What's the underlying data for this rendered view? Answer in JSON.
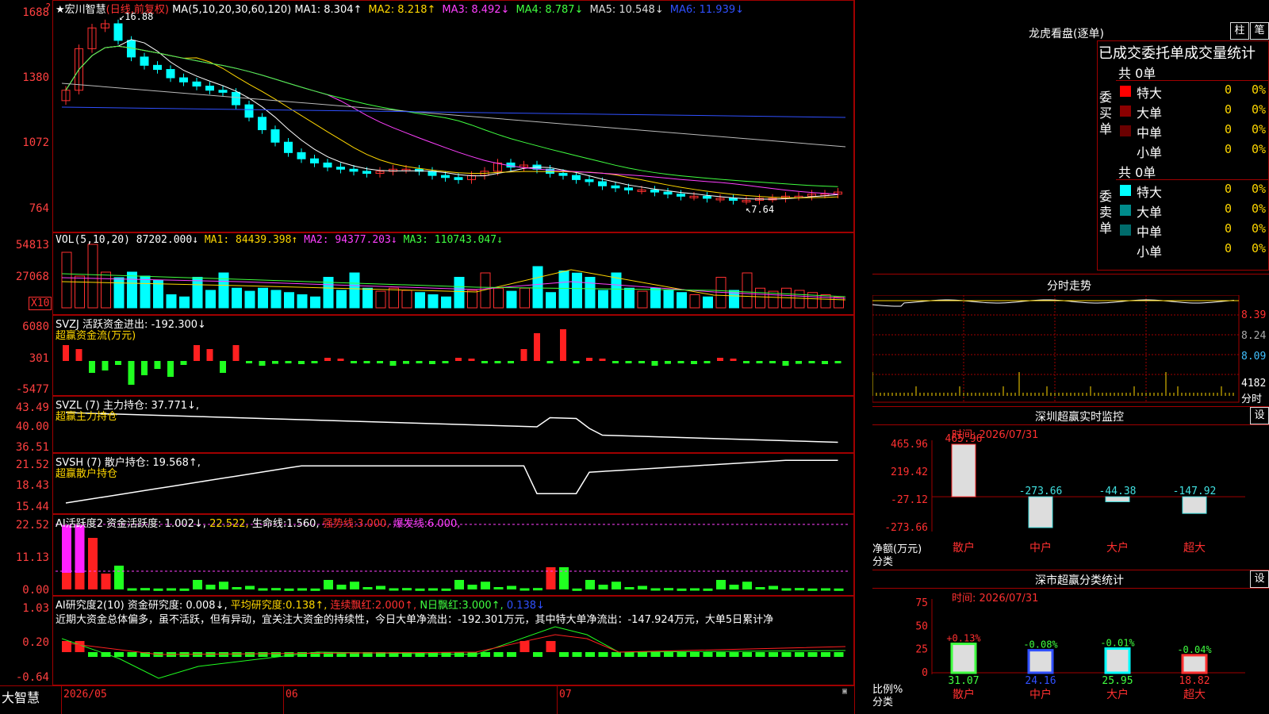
{
  "stock": {
    "title": "★宏川智慧",
    "period": "(日线,前复权)"
  },
  "ma_legend": {
    "label": "MA(5,10,20,30,60,120)",
    "items": [
      {
        "name": "MA1:",
        "value": "8.304↑",
        "color": "#ffffff"
      },
      {
        "name": "MA2:",
        "value": "8.218↑",
        "color": "#ffd700"
      },
      {
        "name": "MA3:",
        "value": "8.492↓",
        "color": "#ff40ff"
      },
      {
        "name": "MA4:",
        "value": "8.787↓",
        "color": "#40ff40"
      },
      {
        "name": "MA5:",
        "value": "10.548↓",
        "color": "#dddddd"
      },
      {
        "name": "MA6:",
        "value": "11.939↓",
        "color": "#3050ff"
      }
    ]
  },
  "price_axis": [
    "1688",
    "1380",
    "1072",
    "764"
  ],
  "price_marks": {
    "high": "16.88",
    "low": "7.64"
  },
  "vol_legend": {
    "label": "VOL(5,10,20)",
    "value": "87202.000↓",
    "items": [
      {
        "name": "MA1:",
        "value": "84439.398↑",
        "color": "#ffd700"
      },
      {
        "name": "MA2:",
        "value": "94377.203↓",
        "color": "#ff40ff"
      },
      {
        "name": "MA3:",
        "value": "110743.047↓",
        "color": "#40ff40"
      }
    ]
  },
  "vol_axis": [
    "54813",
    "27068"
  ],
  "vol_unit": "X10",
  "svzj": {
    "label": "SVZJ",
    "text": "活跃资金进出:",
    "value": "-192.300↓",
    "sub": "超赢资金流(万元)",
    "axis": [
      "6080",
      "301",
      "-5477"
    ]
  },
  "svzl": {
    "label": "SVZL (7)",
    "text": "主力持仓:",
    "value": "37.771↓,",
    "sub": "超赢主力持仓",
    "axis": [
      "43.49",
      "40.00",
      "36.51"
    ]
  },
  "svsh": {
    "label": "SVSH (7)",
    "text": "散户持仓:",
    "value": "19.568↑,",
    "sub": "超赢散户持仓",
    "axis": [
      "21.52",
      "18.43",
      "15.44"
    ]
  },
  "ai1": {
    "label": "AI活跃度2",
    "text": "资金活跃度:",
    "v1": "1.002↓,",
    "v2": "22.522,",
    "t3": "生命线:",
    "v3": "1.560,",
    "t4": "强势线:",
    "v4": "3.000,",
    "t5": "爆发线:",
    "v5": "6.000,",
    "axis": [
      "22.52",
      "11.13",
      "0.00"
    ]
  },
  "ai2": {
    "label": "AI研究度2(10)",
    "text": "资金研究度:",
    "v1": "0.008↓,",
    "t2": "平均研究度:",
    "v2": "0.138↑,",
    "t3": "连续飘红:",
    "v3": "2.000↑,",
    "t4": "N日飘红:",
    "v4": "3.000↑,",
    "v5": "0.138↓",
    "comment": "近期大资金总体偏多，虽不活跃，但有异动，宜关注大资金的持续性，今日大单净流出：-192.301万元，其中特大单净流出：-147.924万元，大单5日累计净",
    "axis": [
      "1.03",
      "0.20",
      "-0.64"
    ]
  },
  "date_axis": [
    "2026/05",
    "06",
    "07"
  ],
  "brand": "大智慧",
  "right": {
    "lhb_title": "龙虎看盘(逐单)",
    "btn_zhu": "柱",
    "btn_bi": "笔",
    "stats_header": "已成交委托单成交量统计",
    "buy": {
      "side": "委买单",
      "total": "共 0单",
      "rows": [
        {
          "label": "特大",
          "count": "0",
          "pct": "0%",
          "color": "#ff0000"
        },
        {
          "label": "大单",
          "count": "0",
          "pct": "0%",
          "color": "#8b0000"
        },
        {
          "label": "中单",
          "count": "0",
          "pct": "0%",
          "color": "#6a0000"
        },
        {
          "label": "小单",
          "count": "0",
          "pct": "0%",
          "color": "#000000"
        }
      ]
    },
    "sell": {
      "side": "委卖单",
      "total": "共 0单",
      "rows": [
        {
          "label": "特大",
          "count": "0",
          "pct": "0%",
          "color": "#00ffff"
        },
        {
          "label": "大单",
          "count": "0",
          "pct": "0%",
          "color": "#008b8b"
        },
        {
          "label": "中单",
          "count": "0",
          "pct": "0%",
          "color": "#006b6b"
        },
        {
          "label": "小单",
          "count": "0",
          "pct": "0%",
          "color": "#000000"
        }
      ]
    },
    "fenshi_title": "分时走势",
    "fenshi_axis": [
      "8.39",
      "8.24",
      "8.09"
    ],
    "fenshi_vol": "4182",
    "fenshi_unit": "分时",
    "monitor_title": "深圳超赢实时监控",
    "btn_set": "设",
    "monitor_time": "时间: 2026/07/31",
    "monitor_axis": [
      "465.96",
      "219.42",
      "-27.12",
      "-273.66"
    ],
    "monitor_ylabel": "净额(万元)",
    "monitor_xlabel": "分类",
    "monitor_bars": [
      {
        "label": "散户",
        "value": "465.96",
        "v": 465.96,
        "color": "#ff3030"
      },
      {
        "label": "中户",
        "value": "-273.66",
        "v": -273.66,
        "color": "#40e0e0"
      },
      {
        "label": "大户",
        "value": "-44.38",
        "v": -44.38,
        "color": "#40e0e0"
      },
      {
        "label": "超大",
        "value": "-147.92",
        "v": -147.92,
        "color": "#40e0e0"
      }
    ],
    "cls_title": "深市超赢分类统计",
    "cls_time": "时间: 2026/07/31",
    "cls_axis": [
      "75",
      "50",
      "25",
      "0"
    ],
    "cls_ylabel": "比例%",
    "cls_xlabel": "分类",
    "cls_bars": [
      {
        "label": "散户",
        "value": "31.07",
        "v": 31.07,
        "change": "+0.13%",
        "change_color": "#ff3030",
        "color": "#40ff40",
        "vcolor": "#40ff40"
      },
      {
        "label": "中户",
        "value": "24.16",
        "v": 24.16,
        "change": "-0.08%",
        "change_color": "#40ff40",
        "color": "#3050ff",
        "vcolor": "#3050ff"
      },
      {
        "label": "大户",
        "value": "25.95",
        "v": 25.95,
        "change": "-0.01%",
        "change_color": "#40ff40",
        "color": "#00ffff",
        "vcolor": "#40ff40"
      },
      {
        "label": "超大",
        "value": "18.82",
        "v": 18.82,
        "change": "-0.04%",
        "change_color": "#40ff40",
        "color": "#ff3030",
        "vcolor": "#ff3030"
      }
    ]
  }
}
